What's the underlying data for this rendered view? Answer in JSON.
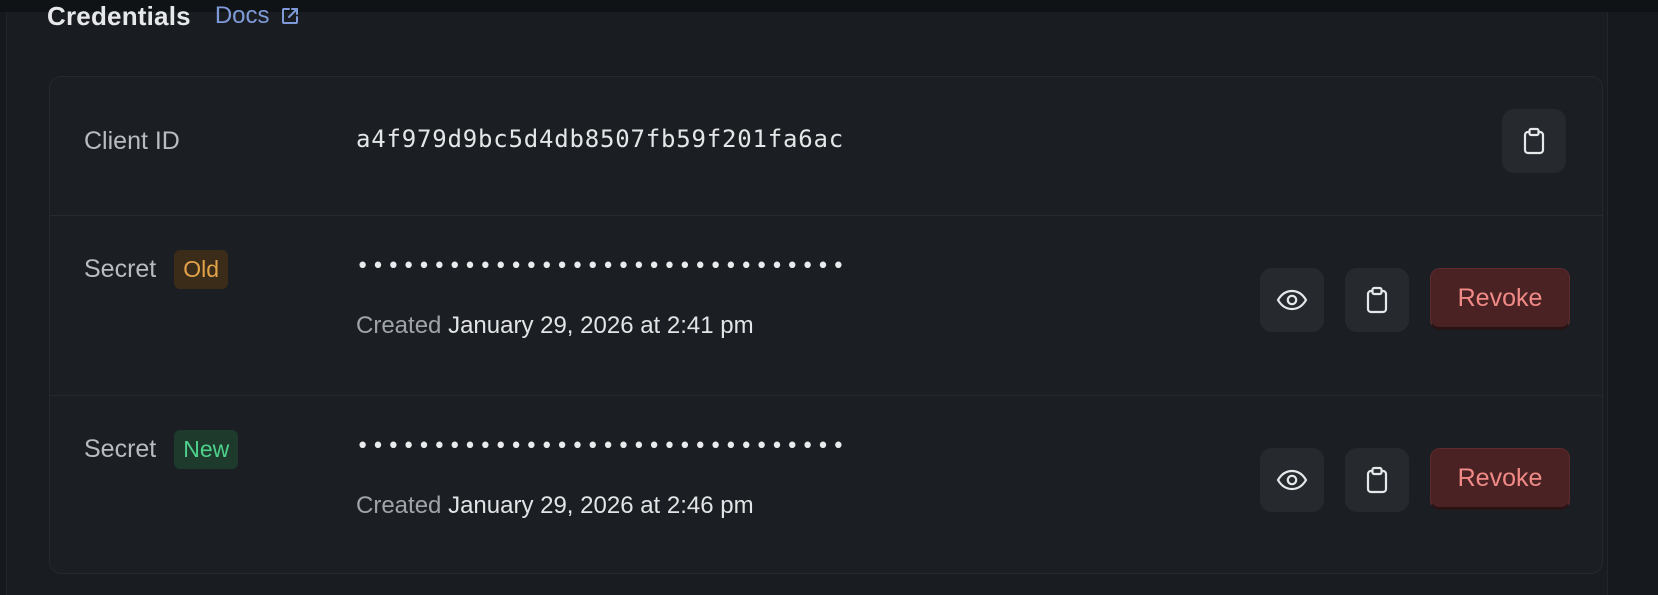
{
  "header": {
    "title": "Credentials",
    "docs_label": "Docs",
    "docs_icon": "external-link-icon"
  },
  "client": {
    "label": "Client ID",
    "value": "a4f979d9bc5d4db8507fb59f201fa6ac",
    "copy_icon": "clipboard-icon"
  },
  "secrets": [
    {
      "label": "Secret",
      "badge": "Old",
      "badge_color": "#e2a24a",
      "masked": "••••••••••••••••••••••••••••••••",
      "created_prefix": "Created",
      "created_date": "January 29, 2026 at 2:41 pm",
      "revoke_label": "Revoke"
    },
    {
      "label": "Secret",
      "badge": "New",
      "badge_color": "#4fd18c",
      "masked": "••••••••••••••••••••••••••••••••",
      "created_prefix": "Created",
      "created_date": "January 29, 2026 at 2:46 pm",
      "revoke_label": "Revoke"
    }
  ],
  "icons": {
    "reveal": "eye-icon",
    "copy": "clipboard-icon"
  },
  "colors": {
    "accent_link": "#7f9ad8",
    "danger": "#f08a86",
    "danger_bg": "#4a2224"
  }
}
